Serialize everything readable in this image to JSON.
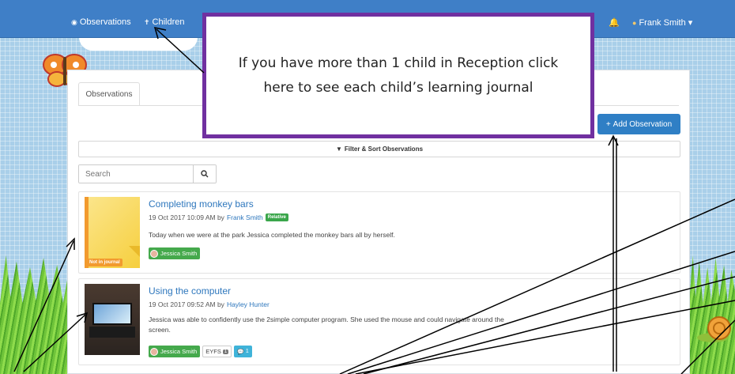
{
  "navbar": {
    "observations_label": "Observations",
    "children_label": "Children",
    "user_name": "Frank Smith",
    "caret": "▾"
  },
  "tabs": [
    {
      "label": "Observations"
    }
  ],
  "toolbar": {
    "add_label": "Add Observation",
    "filter_label": "Filter & Sort Observations"
  },
  "search": {
    "placeholder": "Search"
  },
  "observations": [
    {
      "title": "Completing monkey bars",
      "date": "19 Oct 2017 10:09 AM by",
      "author": "Frank Smith",
      "author_badge": "Relative",
      "text": "Today when we were at the park Jessica completed the monkey bars all by herself.",
      "status_badge": "Not in journal",
      "child": "Jessica Smith"
    },
    {
      "title": "Using the computer",
      "date": "19 Oct 2017 09:52 AM by",
      "author": "Hayley Hunter",
      "text": "Jessica was able to confidently use the 2simple computer program. She used the mouse and could navigate around the screen.",
      "child": "Jessica Smith",
      "eyfs_label": "EYFS",
      "eyfs_count": "1",
      "comment_count": "1"
    }
  ],
  "callout": {
    "text": "If you have more than 1 child in Reception click here to see each child’s learning journal",
    "border_color": "#7030a0"
  },
  "colors": {
    "navbar": "#3f7fc7",
    "primary": "#2f7fc5",
    "success": "#45a94c",
    "warning": "#f29a2e"
  }
}
